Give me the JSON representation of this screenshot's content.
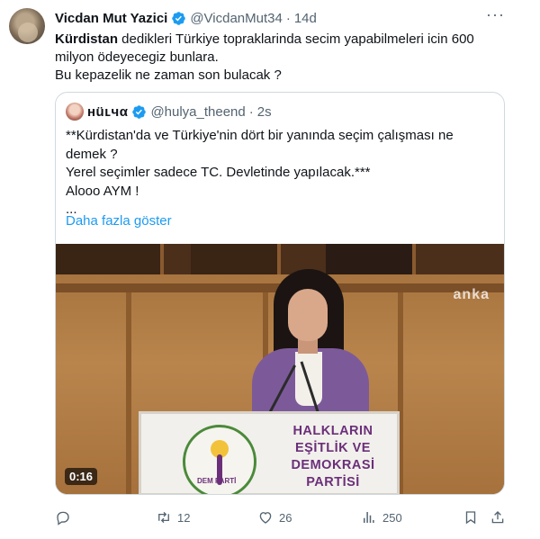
{
  "author": {
    "name": "Vicdan Mut Yazici",
    "handle": "@VicdanMut34",
    "separator": "·",
    "time": "14d",
    "avatar_icon": "profile-avatar"
  },
  "tweet": {
    "bold_word": "Kürdistan",
    "line1_rest": " dedikleri Türkiye topraklarinda secim yapabilmeleri icin 600",
    "line2": "milyon ödeyecegiz bunlara.",
    "line3": "Bu kepazelik ne zaman son bulacak ?"
  },
  "quoted": {
    "name": "нüʟчα",
    "handle": "@hulya_theend",
    "separator": "·",
    "time": "2s",
    "lines": [
      "**Kürdistan'da ve Türkiye'nin dört bir yanında seçim çalışması ne",
      "demek ?",
      "Yerel seçimler sadece TC. Devletinde yapılacak.***",
      "Aloоo AYM !",
      "..."
    ],
    "show_more": "Daha fazla göster",
    "video": {
      "duration": "0:16",
      "watermark": "anka",
      "podium_lines": [
        "HALKLARIN",
        "EŞİTLİK VE",
        "DEMOKRASİ",
        "PARTİSİ"
      ],
      "logo_label": "DEM PARTİ"
    }
  },
  "actions": {
    "reply_count": "",
    "retweet_count": "12",
    "like_count": "26",
    "views_count": "250"
  },
  "colors": {
    "text": "#0f1419",
    "secondary": "#536471",
    "link": "#1d9bf0",
    "verified": "#1d9bf0",
    "border": "#cfd9de"
  }
}
